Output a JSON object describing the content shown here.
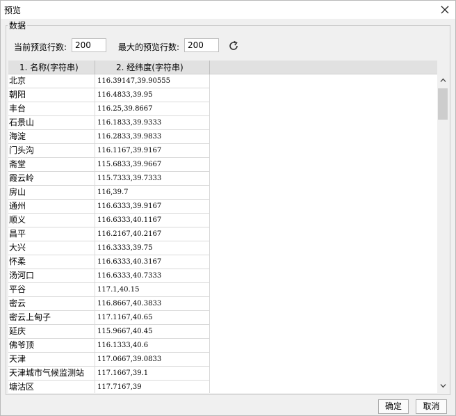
{
  "window": {
    "title": "预览"
  },
  "group": {
    "label": "数据"
  },
  "controls": {
    "current_rows_label": "当前预览行数:",
    "current_rows_value": "200",
    "max_rows_label": "最大的预览行数:",
    "max_rows_value": "200",
    "refresh_icon": "refresh-icon"
  },
  "table": {
    "columns": [
      "1. 名称(字符串)",
      "2. 经纬度(字符串)"
    ],
    "rows": [
      [
        "北京",
        "116.39147,39.90555"
      ],
      [
        "朝阳",
        "116.4833,39.95"
      ],
      [
        "丰台",
        "116.25,39.8667"
      ],
      [
        "石景山",
        "116.1833,39.9333"
      ],
      [
        "海淀",
        "116.2833,39.9833"
      ],
      [
        "门头沟",
        "116.1167,39.9167"
      ],
      [
        "斋堂",
        "115.6833,39.9667"
      ],
      [
        "霞云岭",
        "115.7333,39.7333"
      ],
      [
        "房山",
        "116,39.7"
      ],
      [
        "通州",
        "116.6333,39.9167"
      ],
      [
        "顺义",
        "116.6333,40.1167"
      ],
      [
        "昌平",
        "116.2167,40.2167"
      ],
      [
        "大兴",
        "116.3333,39.75"
      ],
      [
        "怀柔",
        "116.6333,40.3167"
      ],
      [
        "汤河口",
        "116.6333,40.7333"
      ],
      [
        "平谷",
        "117.1,40.15"
      ],
      [
        "密云",
        "116.8667,40.3833"
      ],
      [
        "密云上甸子",
        "117.1167,40.65"
      ],
      [
        "延庆",
        "115.9667,40.45"
      ],
      [
        "佛爷顶",
        "116.1333,40.6"
      ],
      [
        "天津",
        "117.0667,39.0833"
      ],
      [
        "天津城市气候监测站",
        "117.1667,39.1"
      ],
      [
        "塘沽区",
        "117.7167,39"
      ]
    ]
  },
  "buttons": {
    "ok": "确定",
    "cancel": "取消"
  }
}
